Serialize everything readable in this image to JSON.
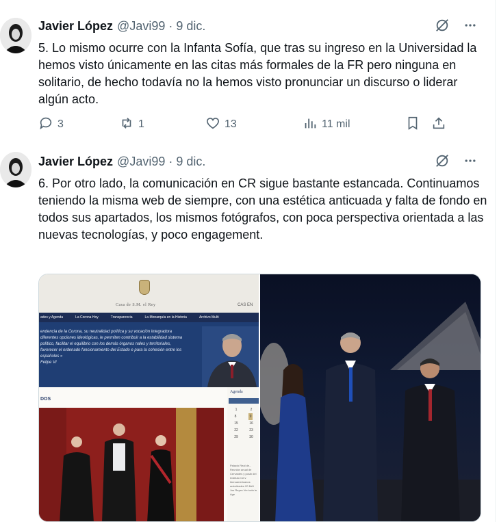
{
  "tweets": [
    {
      "author": {
        "name": "Javier López",
        "handle": "@Javi99"
      },
      "separator": "·",
      "date": "9 dic.",
      "text": "5. Lo mismo ocurre con la Infanta Sofía, que tras su ingreso en la Universidad la hemos visto únicamente en las citas más formales de la FR pero ninguna en solitario, de hecho todavía no la hemos visto pronunciar un discurso o liderar algún acto.",
      "stats": {
        "replies": "3",
        "reposts": "1",
        "likes": "13",
        "views": "11 mil"
      }
    },
    {
      "author": {
        "name": "Javier López",
        "handle": "@Javi99"
      },
      "separator": "·",
      "date": "9 dic.",
      "text": "6. Por otro lado, la comunicación en CR sigue bastante estancada. Continuamos teniendo la misma web de siempre, con una estética anticuada y falta de fondo en todos sus apartados, los mismos fotógrafos, con poca perspectiva orientada a las nuevas tecnologías, y poco engagement.",
      "website": {
        "title": "Casa de S.M. el Rey",
        "lang": "CAS    EN",
        "nav": [
          "ades y Agenda",
          "La Corona Hoy",
          "Transparencia",
          "La Monarquía en la Historia",
          "Archivo Multi"
        ],
        "hero_text": "endencia de la Corona, su neutralidad política y su vocación integradora diferentes opciones ideológicas, le permiten contribuir a la estabilidad sistema político, facilitar el equilibrio con los demás órganos nales y territoriales, favorecer el ordenado funcionamiento del Estado e para la cohesión entre los españoles »",
        "hero_sign": "Felipe VI",
        "section": "DOS",
        "agenda_title": "Agenda",
        "agenda_days": [
          "1",
          "8",
          "15",
          "22",
          "29",
          "2",
          "9",
          "16",
          "23",
          "30"
        ],
        "agenda_text": "Palacio Real de... Reunión anual de Cervantes y posib del Instituto Cerv iberoamericanos autoridades  20 MAI Jos Reyes  Ver toda la Age"
      }
    }
  ],
  "icons": [
    "grok-icon",
    "more-icon",
    "reply-icon",
    "repost-icon",
    "like-icon",
    "views-icon",
    "bookmark-icon",
    "share-icon"
  ]
}
